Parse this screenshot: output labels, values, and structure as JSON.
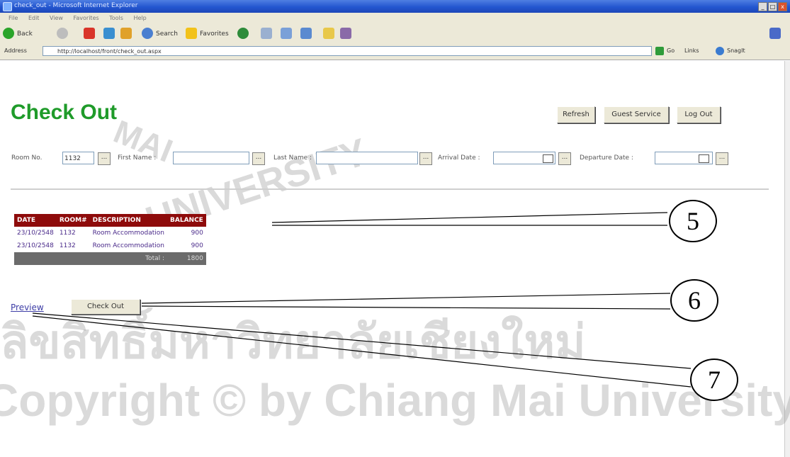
{
  "window": {
    "title": "check_out - Microsoft Internet Explorer",
    "controls": [
      "_",
      "□",
      "x"
    ]
  },
  "menu": [
    "File",
    "Edit",
    "View",
    "Favorites",
    "Tools",
    "Help"
  ],
  "toolbar": {
    "back": "Back",
    "search": "Search",
    "favorites": "Favorites"
  },
  "address": {
    "label": "Address",
    "url": "http://localhost/front/check_out.aspx",
    "go": "Go",
    "links": "Links",
    "snagit": "SnagIt"
  },
  "page": {
    "title": "Check Out",
    "buttons": {
      "refresh": "Refresh",
      "guest_service": "Guest Service",
      "logout": "Log Out"
    },
    "search": {
      "room_label": "Room No.",
      "room_value": "1132",
      "first_name_label": "First Name :",
      "last_name_label": "Last Name :",
      "arrival_label": "Arrival Date :",
      "departure_label": "Departure Date :",
      "ellipsis": "..."
    },
    "folio": {
      "headers": [
        "DATE",
        "ROOM#",
        "DESCRIPTION",
        "BALANCE"
      ],
      "rows": [
        [
          "23/10/2548",
          "1132",
          "Room Accommodation",
          "900"
        ],
        [
          "23/10/2548",
          "1132",
          "Room Accommodation",
          "900"
        ]
      ],
      "total_label": "Total :",
      "total_value": "1800"
    },
    "preview_link": "Preview",
    "checkout_button": "Check Out"
  },
  "callouts": [
    "5",
    "6",
    "7"
  ],
  "watermark": {
    "university": "UNIVERSITY",
    "thai": "ลิขสิทธิ์มหาวิทยาลัยเชียงใหม่",
    "copyright": "Copyright © by Chiang Mai University",
    "mai": "MAI"
  },
  "colors": {
    "title_green": "#1f9b2a",
    "header_red": "#8e0b0b",
    "link_purple": "#3d3da6"
  }
}
